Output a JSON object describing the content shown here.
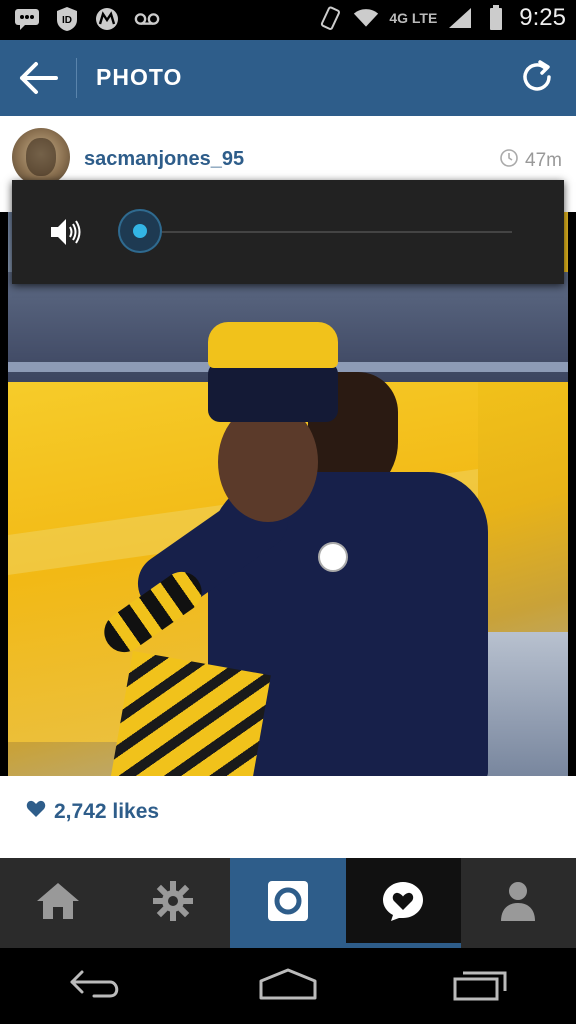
{
  "status_bar": {
    "time": "9:25",
    "network": "4G LTE",
    "icons": [
      "messages-icon",
      "id-icon",
      "motorola-icon",
      "voicemail-icon",
      "rotate-icon",
      "wifi-icon",
      "signal-icon",
      "battery-icon"
    ]
  },
  "header": {
    "title": "PHOTO",
    "back_icon": "arrow-left-icon",
    "refresh_icon": "refresh-icon",
    "bg_color": "#2e5d8a"
  },
  "post": {
    "username": "sacmanjones_95",
    "time_ago": "47m",
    "likes": "2,742 likes"
  },
  "volume_overlay": {
    "icon": "speaker-icon",
    "level": 0.0
  },
  "tabs": [
    {
      "name": "home",
      "icon": "home-icon",
      "state": "normal"
    },
    {
      "name": "explore",
      "icon": "explore-icon",
      "state": "normal"
    },
    {
      "name": "camera",
      "icon": "camera-icon",
      "state": "blue"
    },
    {
      "name": "activity",
      "icon": "activity-icon",
      "state": "selected"
    },
    {
      "name": "profile",
      "icon": "profile-icon",
      "state": "normal"
    }
  ],
  "nav_bar": [
    "back-icon",
    "home-icon",
    "recents-icon"
  ]
}
